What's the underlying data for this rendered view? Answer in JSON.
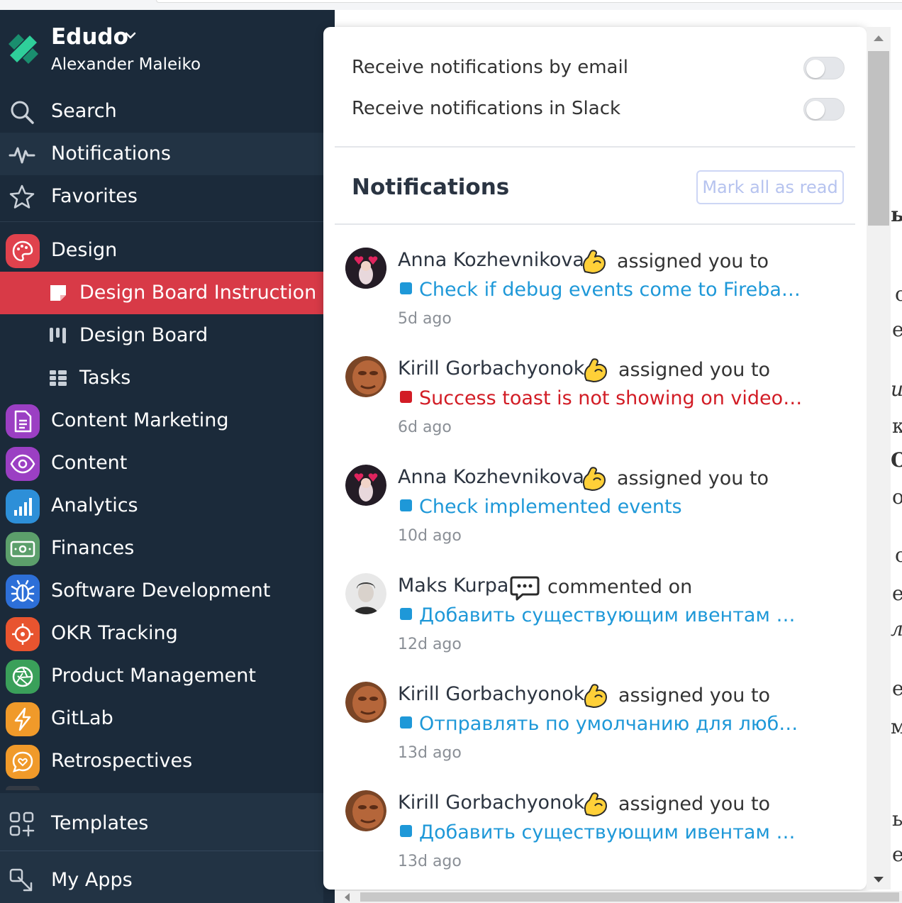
{
  "workspace": {
    "name": "Edudo",
    "user": "Alexander Maleiko"
  },
  "nav": {
    "search": "Search",
    "notifications": "Notifications",
    "favorites": "Favorites"
  },
  "apps": {
    "design": "Design",
    "design_board_instruction": "Design Board Instruction",
    "design_board": "Design Board",
    "tasks": "Tasks",
    "content_marketing": "Content Marketing",
    "content": "Content",
    "analytics": "Analytics",
    "finances": "Finances",
    "software_development": "Software Development",
    "okr_tracking": "OKR Tracking",
    "product_management": "Product Management",
    "gitlab": "GitLab",
    "retrospectives": "Retrospectives"
  },
  "bottom": {
    "templates": "Templates",
    "my_apps": "My Apps"
  },
  "settings": {
    "email_label": "Receive notifications by email",
    "email_enabled": false,
    "slack_label": "Receive notifications in Slack",
    "slack_enabled": false
  },
  "panel": {
    "title": "Notifications",
    "mark_all_label": "Mark all as read"
  },
  "notifications": [
    {
      "user": "Anna Kozhevnikova",
      "action": "assigned you to",
      "emoji": "flexed-biceps",
      "task": "Check if debug events come to Firebase. ...",
      "status_color": "#1e98d8",
      "time": "5d ago"
    },
    {
      "user": "Kirill Gorbachyonok",
      "action": "assigned you to",
      "emoji": "flexed-biceps",
      "task": "Success toast is not showing on video save",
      "status_color": "#d21c25",
      "time": "6d ago"
    },
    {
      "user": "Anna Kozhevnikova",
      "action": "assigned you to",
      "emoji": "flexed-biceps",
      "task": "Check implemented events",
      "status_color": "#1e98d8",
      "time": "10d ago"
    },
    {
      "user": "Maks Kurpa",
      "action": "commented on",
      "emoji": "speech-bubble",
      "task": "Добавить существующим ивентам токе...",
      "status_color": "#1e98d8",
      "time": "12d ago"
    },
    {
      "user": "Kirill Gorbachyonok",
      "action": "assigned you to",
      "emoji": "flexed-biceps",
      "task": "Отправлять по умолчанию для любого ...",
      "status_color": "#1e98d8",
      "time": "13d ago"
    },
    {
      "user": "Kirill Gorbachyonok",
      "action": "assigned you to",
      "emoji": "flexed-biceps",
      "task": "Добавить существующим ивентам токе...",
      "status_color": "#1e98d8",
      "time": "13d ago"
    }
  ],
  "colors": {
    "sidebar_bg": "#1b2a3a",
    "selected_bg": "#d83a47",
    "link_blue": "#1e98d8",
    "link_red": "#d21c25"
  },
  "background_edge_glyphs": [
    "ь",
    "с",
    "е",
    "и",
    "к",
    "О",
    "о",
    "с",
    "е",
    "л",
    "е",
    "м",
    "ь",
    "е"
  ]
}
